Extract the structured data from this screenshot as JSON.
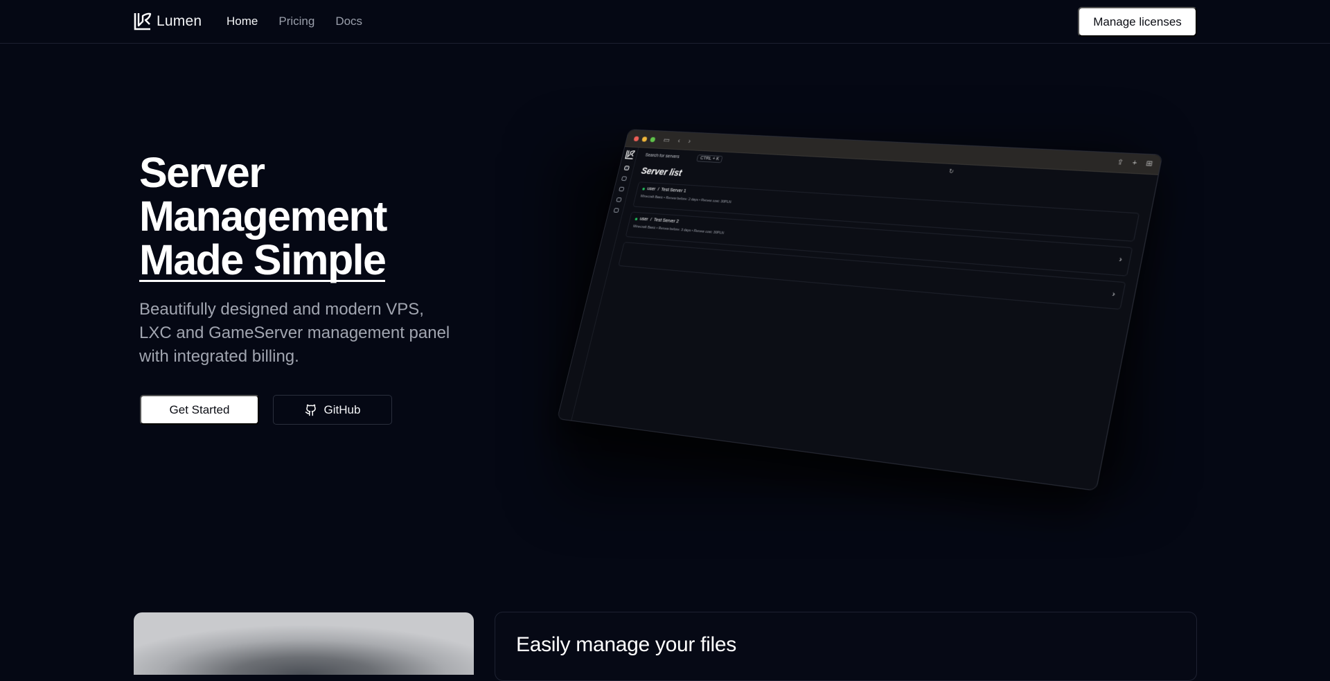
{
  "brand": {
    "name": "Lumen"
  },
  "nav": {
    "links": [
      {
        "label": "Home",
        "active": true
      },
      {
        "label": "Pricing",
        "active": false
      },
      {
        "label": "Docs",
        "active": false
      }
    ],
    "cta_label": "Manage licenses"
  },
  "hero": {
    "title_line1": "Server",
    "title_line2": "Management",
    "title_line3": "Made Simple",
    "subtitle": "Beautifully designed and modern VPS, LXC and GameServer management panel with integrated billing.",
    "primary_button": "Get Started",
    "secondary_button": "GitHub",
    "secondary_icon": "github-icon"
  },
  "mockup": {
    "search_placeholder": "Search for servers",
    "search_shortcut": "CTRL + K",
    "heading": "Server list",
    "servers": [
      {
        "owner": "user",
        "name": "Test Server 1",
        "meta": "Minecraft Basic • Renew before: 2 days • Renew cost: 30PLN"
      },
      {
        "owner": "user",
        "name": "Test Server 2",
        "meta": "Minecraft Basic • Renew before: 3 days • Renew cost: 30PLN"
      }
    ]
  },
  "features": {
    "files_heading": "Easily manage your  files"
  },
  "colors": {
    "background": "#050814",
    "accent_white": "#ffffff",
    "muted_text": "#a1a5b0",
    "status_online": "#22c55e"
  }
}
